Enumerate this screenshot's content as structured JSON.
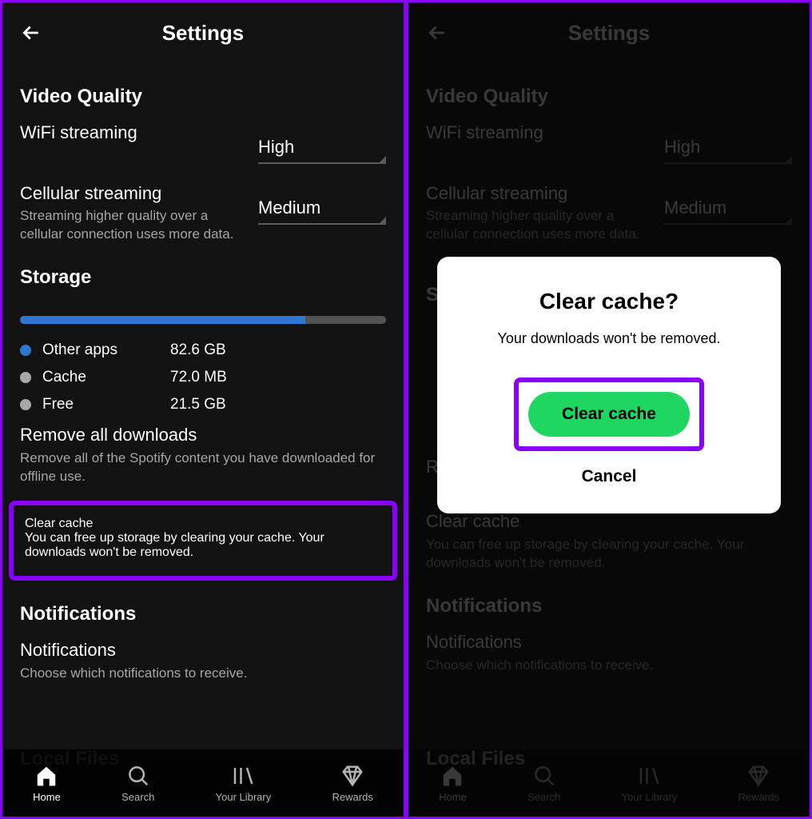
{
  "left": {
    "header": {
      "title": "Settings"
    },
    "video_quality": {
      "title": "Video Quality",
      "wifi_label": "WiFi streaming",
      "wifi_value": "High",
      "cell_label": "Cellular streaming",
      "cell_sub": "Streaming higher quality over a cellular connection uses more data.",
      "cell_value": "Medium"
    },
    "storage": {
      "title": "Storage",
      "bar_percent_other": 78,
      "legend": {
        "other_label": "Other apps",
        "other_value": "82.6 GB",
        "other_color": "#2e77d0",
        "cache_label": "Cache",
        "cache_value": "72.0 MB",
        "cache_color": "#a7a7a7",
        "free_label": "Free",
        "free_value": "21.5 GB",
        "free_color": "#a7a7a7"
      },
      "remove_title": "Remove all downloads",
      "remove_sub": "Remove all of the Spotify content you have downloaded for offline use.",
      "clear_title": "Clear cache",
      "clear_sub": "You can free up storage by clearing your cache. Your downloads won't be removed."
    },
    "notifications": {
      "title": "Notifications",
      "row_title": "Notifications",
      "row_sub": "Choose which notifications to receive."
    },
    "bg_section": "Local Files",
    "nav": {
      "home": "Home",
      "search": "Search",
      "library": "Your Library",
      "rewards": "Rewards"
    }
  },
  "right": {
    "header": {
      "title": "Settings"
    },
    "video_quality": {
      "title": "Video Quality",
      "wifi_label": "WiFi streaming",
      "wifi_value": "High",
      "cell_label": "Cellular streaming",
      "cell_sub": "Streaming higher quality over a cellular connection uses more data.",
      "cell_value": "Medium"
    },
    "storage": {
      "title": "S",
      "remove_title_fragment": "R",
      "clear_title": "Clear cache",
      "clear_sub": "You can free up storage by clearing your cache. Your downloads won't be removed."
    },
    "notifications": {
      "title": "Notifications",
      "row_title": "Notifications",
      "row_sub": "Choose which notifications to receive."
    },
    "bg_section": "Local Files",
    "nav": {
      "home": "Home",
      "search": "Search",
      "library": "Your Library",
      "rewards": "Rewards"
    },
    "modal": {
      "title": "Clear cache?",
      "sub": "Your downloads won't be removed.",
      "confirm": "Clear cache",
      "cancel": "Cancel"
    }
  }
}
